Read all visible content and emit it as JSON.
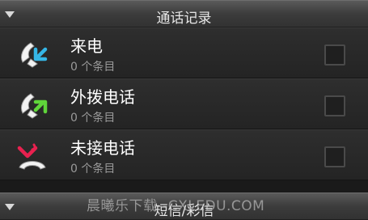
{
  "header_top": {
    "title": "通话记录"
  },
  "items": [
    {
      "name": "来电",
      "count": "0 个条目",
      "icon": "incoming-call-icon",
      "accent": "#35b6e6"
    },
    {
      "name": "外拨电话",
      "count": "0 个条目",
      "icon": "outgoing-call-icon",
      "accent": "#5fd43a"
    },
    {
      "name": "未接电话",
      "count": "0 个条目",
      "icon": "missed-call-icon",
      "accent": "#e8214f"
    }
  ],
  "header_bottom": {
    "title": "短信/彩信"
  },
  "watermark": "晨曦乐下载--CXLEDU.COM",
  "colors": {
    "background": "#1a1a1a",
    "header": "#3c3c3c",
    "count_text": "#9a9a9a"
  }
}
